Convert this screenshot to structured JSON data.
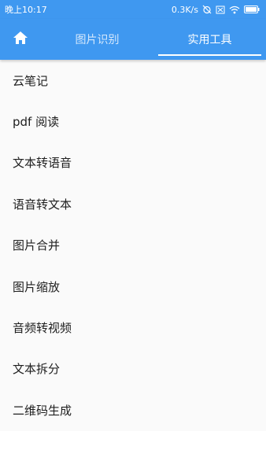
{
  "status_bar": {
    "time": "晚上10:17",
    "net_speed": "0.3K/s",
    "icons": [
      "alarm-off-icon",
      "sim-off-icon",
      "wifi-icon",
      "battery-icon"
    ]
  },
  "app_bar": {
    "home_icon": "home-icon",
    "tabs": [
      {
        "label": "图片识别",
        "active": false
      },
      {
        "label": "实用工具",
        "active": true
      }
    ],
    "color": "#3f98f0"
  },
  "tools": [
    "云笔记",
    "pdf 阅读",
    "文本转语音",
    "语音转文本",
    "图片合并",
    "图片缩放",
    "音频转视频",
    "文本拆分",
    "二维码生成"
  ]
}
